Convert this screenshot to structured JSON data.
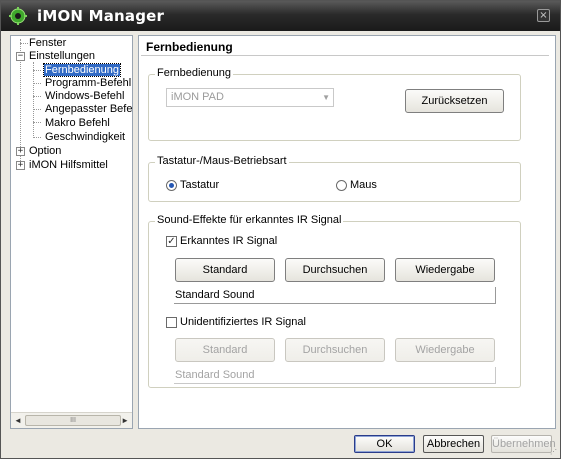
{
  "window": {
    "title": "iMON Manager",
    "close_glyph": "×"
  },
  "tree": {
    "items": [
      {
        "label": "Fenster",
        "expander": ""
      },
      {
        "label": "Einstellungen",
        "expander": "−"
      },
      {
        "label": "Fernbedienung",
        "expander": ""
      },
      {
        "label": "Programm-Befehl",
        "expander": ""
      },
      {
        "label": "Windows-Befehl",
        "expander": ""
      },
      {
        "label": "Angepasster Befel",
        "expander": ""
      },
      {
        "label": "Makro  Befehl",
        "expander": ""
      },
      {
        "label": "Geschwindigkeit",
        "expander": ""
      },
      {
        "label": "Option",
        "expander": "+"
      },
      {
        "label": "iMON Hilfsmittel",
        "expander": "+"
      }
    ],
    "selected_index": 2,
    "scroll_left": "◄",
    "scroll_right": "►",
    "scroll_thumb": "III"
  },
  "panel": {
    "title": "Fernbedienung",
    "remote_group": {
      "legend": "Fernbedienung",
      "combo_value": "iMON PAD",
      "combo_arrow": "▼",
      "reset_label": "Zurücksetzen"
    },
    "mode_group": {
      "legend": "Tastatur-/Maus-Betriebsart",
      "option_keyboard": "Tastatur",
      "option_mouse": "Maus",
      "selected": "Tastatur"
    },
    "sound_group": {
      "legend": "Sound-Effekte für erkanntes IR Signal",
      "recognized": {
        "label": "Erkanntes IR Signal",
        "checked": true,
        "check_glyph": "✓",
        "btn_standard": "Standard",
        "btn_browse": "Durchsuchen",
        "btn_play": "Wiedergabe",
        "sound": "Standard Sound"
      },
      "unidentified": {
        "label": "Unidentifiziertes IR Signal",
        "checked": false,
        "btn_standard": "Standard",
        "btn_browse": "Durchsuchen",
        "btn_play": "Wiedergabe",
        "sound": "Standard Sound"
      }
    }
  },
  "footer": {
    "ok": "OK",
    "cancel": "Abbrechen",
    "apply": "Übernehmen"
  }
}
